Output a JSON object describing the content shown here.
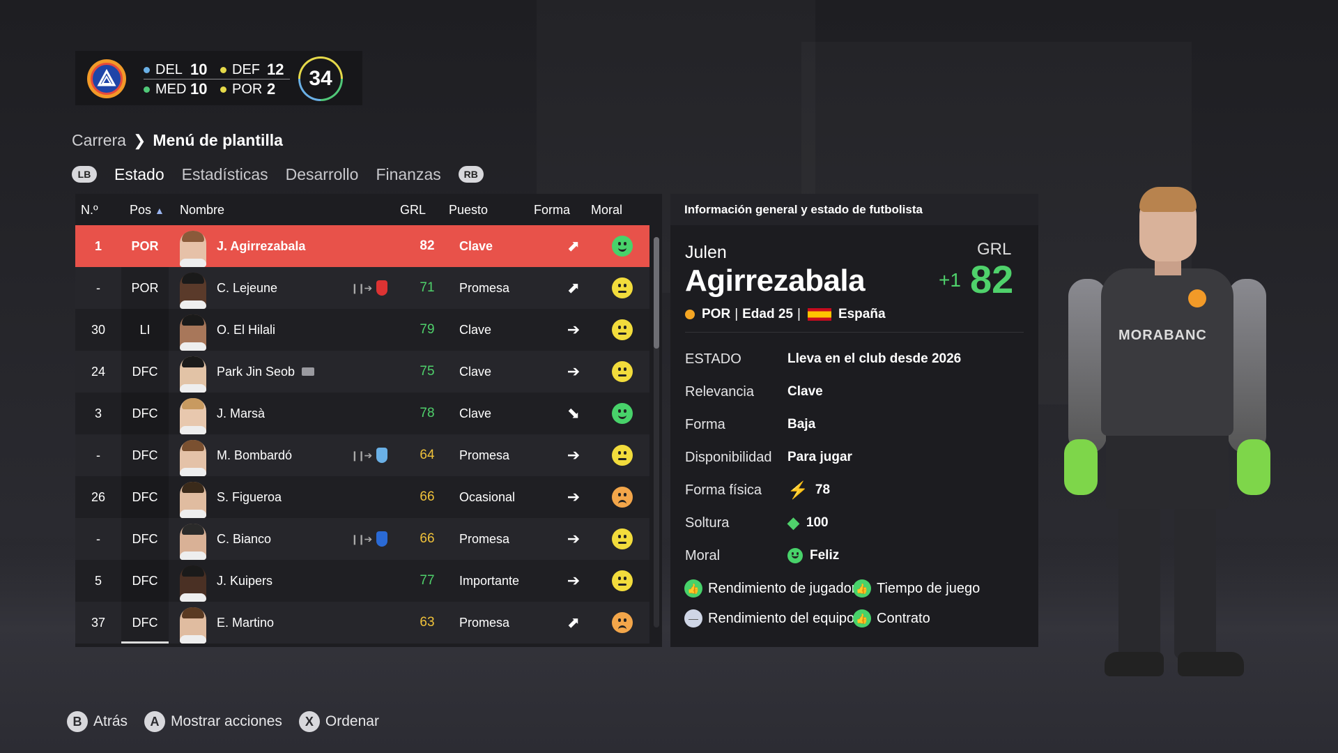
{
  "summary": {
    "counts": [
      {
        "label": "DEL",
        "value": "10",
        "color": "#6ab0e6"
      },
      {
        "label": "DEF",
        "value": "12",
        "color": "#e5d94a"
      },
      {
        "label": "MED",
        "value": "10",
        "color": "#50c878"
      },
      {
        "label": "POR",
        "value": "2",
        "color": "#e5d94a"
      }
    ],
    "total": "34"
  },
  "breadcrumb": {
    "parent": "Carrera",
    "current": "Menú de plantilla"
  },
  "tabs": {
    "lb": "LB",
    "rb": "RB",
    "items": [
      "Estado",
      "Estadísticas",
      "Desarrollo",
      "Finanzas"
    ],
    "active": "Estado"
  },
  "table": {
    "headers": {
      "num": "N.º",
      "pos": "Pos",
      "name": "Nombre",
      "grl": "GRL",
      "puesto": "Puesto",
      "forma": "Forma",
      "moral": "Moral"
    },
    "rows": [
      {
        "num": "1",
        "pos": "POR",
        "name": "J. Agirrezabala",
        "grl": "82",
        "puesto": "Clave",
        "forma": "up",
        "moral": "happy",
        "loan": false,
        "skin": "#e6c1a8",
        "hair": "#8a5a3a"
      },
      {
        "num": "-",
        "pos": "POR",
        "name": "C. Lejeune",
        "grl": "71",
        "puesto": "Promesa",
        "forma": "up",
        "moral": "neutral",
        "loan": true,
        "club": "#d33",
        "skin": "#5a3a2a",
        "hair": "#1a1a1a"
      },
      {
        "num": "30",
        "pos": "LI",
        "name": "O. El Hilali",
        "grl": "79",
        "puesto": "Clave",
        "forma": "right",
        "moral": "neutral",
        "loan": false,
        "skin": "#a8775a",
        "hair": "#1a1a1a"
      },
      {
        "num": "24",
        "pos": "DFC",
        "name": "Park Jin Seob",
        "grl": "75",
        "puesto": "Clave",
        "forma": "right",
        "moral": "neutral",
        "loan": false,
        "tag": true,
        "skin": "#e2c3a6",
        "hair": "#1a1a1a"
      },
      {
        "num": "3",
        "pos": "DFC",
        "name": "J. Marsà",
        "grl": "78",
        "puesto": "Clave",
        "forma": "down",
        "moral": "happy",
        "loan": false,
        "skin": "#e8c8ae",
        "hair": "#c89a60"
      },
      {
        "num": "-",
        "pos": "DFC",
        "name": "M. Bombardó",
        "grl": "64",
        "puesto": "Promesa",
        "forma": "right",
        "moral": "neutral",
        "loan": true,
        "club": "#6ab0e6",
        "skin": "#e4c2a8",
        "hair": "#7a5030"
      },
      {
        "num": "26",
        "pos": "DFC",
        "name": "S. Figueroa",
        "grl": "66",
        "puesto": "Ocasional",
        "forma": "right",
        "moral": "sad",
        "loan": false,
        "skin": "#e0bca0",
        "hair": "#3a2a1a"
      },
      {
        "num": "-",
        "pos": "DFC",
        "name": "C. Bianco",
        "grl": "66",
        "puesto": "Promesa",
        "forma": "right",
        "moral": "neutral",
        "loan": true,
        "club": "#2a6ad6",
        "skin": "#d9b196",
        "hair": "#2a2a2a"
      },
      {
        "num": "5",
        "pos": "DFC",
        "name": "J. Kuipers",
        "grl": "77",
        "puesto": "Importante",
        "forma": "right",
        "moral": "neutral",
        "loan": false,
        "skin": "#4a3024",
        "hair": "#1a1a1a"
      },
      {
        "num": "37",
        "pos": "DFC",
        "name": "E. Martino",
        "grl": "63",
        "puesto": "Promesa",
        "forma": "up",
        "moral": "sad",
        "loan": false,
        "skin": "#e0bca0",
        "hair": "#5a3a22"
      }
    ]
  },
  "info": {
    "title": "Información general y estado de futbolista",
    "first_name": "Julen",
    "last_name": "Agirrezabala",
    "grl_label": "GRL",
    "grl": "82",
    "grl_delta": "+1",
    "position": "POR",
    "age": "Edad 25",
    "nation": "España",
    "estado_label": "ESTADO",
    "estado_value": "Lleva en el club desde 2026",
    "relevancia_label": "Relevancia",
    "relevancia_value": "Clave",
    "forma_label": "Forma",
    "forma_value": "Baja",
    "disp_label": "Disponibilidad",
    "disp_value": "Para jugar",
    "fisica_label": "Forma física",
    "fisica_value": "78",
    "soltura_label": "Soltura",
    "soltura_value": "100",
    "moral_label": "Moral",
    "moral_value": "Feliz",
    "stats": [
      {
        "label": "Rendimiento de jugador",
        "state": "good"
      },
      {
        "label": "Tiempo de juego",
        "state": "good"
      },
      {
        "label": "Rendimiento del equipo",
        "state": "neutral"
      },
      {
        "label": "Contrato",
        "state": "good"
      }
    ]
  },
  "player_figure": {
    "sponsor": "MORABANC"
  },
  "footer": {
    "items": [
      {
        "key": "B",
        "label": "Atrás"
      },
      {
        "key": "A",
        "label": "Mostrar acciones"
      },
      {
        "key": "X",
        "label": "Ordenar"
      }
    ]
  }
}
